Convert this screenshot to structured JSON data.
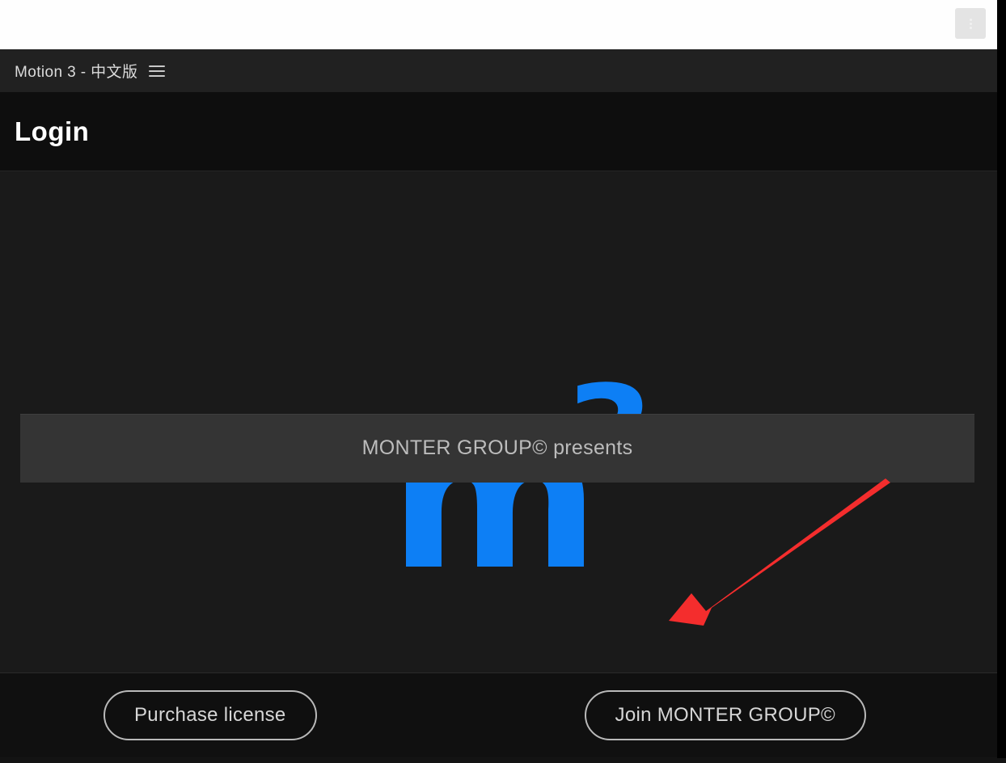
{
  "host_chrome": {
    "menu_button_icon": "vertical-dots-icon"
  },
  "window": {
    "title": "Motion 3 - 中文版",
    "menu_icon": "hamburger-menu-icon"
  },
  "page": {
    "title": "Login"
  },
  "logo": {
    "base": "m",
    "superscript": "3",
    "color": "#0d7ff5"
  },
  "banner": {
    "text": "MONTER GROUP© presents",
    "background": "#343434",
    "text_color": "#bcbcbc"
  },
  "annotation": {
    "type": "arrow",
    "color": "#f42d2d",
    "points_to": "presenter-banner"
  },
  "footer": {
    "purchase_label": "Purchase license",
    "join_label": "Join MONTER GROUP©"
  },
  "colors": {
    "titlebar": "#212121",
    "header": "#0e0e0e",
    "content": "#1a1a1a",
    "footer": "#101010",
    "accent_blue": "#0d7ff5",
    "annotation_red": "#f42d2d"
  }
}
